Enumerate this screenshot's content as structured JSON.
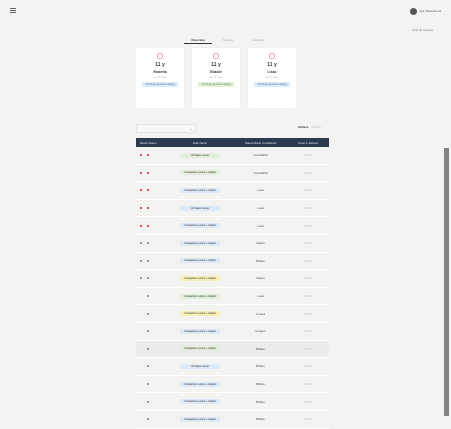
{
  "topbar": {
    "user_name": "Ilya Tiuloutikova",
    "right_link": "Find all reviews"
  },
  "tabs": [
    "Overview",
    "Settings",
    "Analytics"
  ],
  "cards": [
    {
      "value": "11 y",
      "label": "Roberta",
      "sub": "per 30 days",
      "button": "Trend all you have ranking"
    },
    {
      "value": "11 y",
      "label": "Eliasbr",
      "sub": "per 30 days",
      "button": "Trend all you have ranking"
    },
    {
      "value": "11 y",
      "label": "Lisac",
      "sub": "per 30 days",
      "button": "Trend all you have ranking"
    }
  ],
  "filter": {
    "placeholder": "Select region"
  },
  "sort": {
    "a": "Ahhere",
    "b": "Ahhere"
  },
  "table": {
    "headers": [
      "Report Name",
      "Date Name",
      "Status Rank Conditions",
      "Open in Review"
    ],
    "rows": [
      {
        "mark1": "red",
        "mark2": "red",
        "pill": "All Status review",
        "color": "#e1eed9",
        "status": "Gucci&Pat",
        "date": "2/3/42"
      },
      {
        "mark1": "red",
        "mark2": "red",
        "pill": "Comparison reports + insights",
        "color": "#e1eed9",
        "status": "Gucci&Pat",
        "date": "2/3/42"
      },
      {
        "mark1": "red",
        "mark2": "red",
        "pill": "Comparison reports + insights",
        "color": "#dce9f7",
        "status": "Luca",
        "date": "2/3/42"
      },
      {
        "mark1": "red",
        "mark2": "red",
        "pill": "All Status review",
        "color": "#dce9f7",
        "status": "Luca",
        "date": "2/3/42"
      },
      {
        "mark1": "red",
        "mark2": "red",
        "pill": "Comparison reports + insights",
        "color": "#dce9f7",
        "status": "Luca",
        "date": "2/3/42"
      },
      {
        "mark1": "grey",
        "mark2": "grey",
        "pill": "Comparison reports + insights",
        "color": "#dce9f7",
        "status": "Xiaom",
        "date": "2/3/42"
      },
      {
        "mark1": "grey",
        "mark2": "grey",
        "pill": "Comparison reports + insights",
        "color": "#dce9f7",
        "status": "Bifahe",
        "date": "2/3/42"
      },
      {
        "mark1": "grey",
        "mark2": "grey",
        "pill": "Comparison reports + insights",
        "color": "#f7efb8",
        "status": "Xiaom",
        "date": "2/3/42"
      },
      {
        "mark1": "none",
        "mark2": "grey",
        "pill": "Comparison reports + insights",
        "color": "#e1eed9",
        "status": "Luca",
        "date": "2/3/42"
      },
      {
        "mark1": "none",
        "mark2": "grey",
        "pill": "Comparison reports + insights",
        "color": "#f7efb8",
        "status": "C-taua",
        "date": "2/3/42"
      },
      {
        "mark1": "none",
        "mark2": "grey",
        "pill": "Comparison reports + insights",
        "color": "#dce9f7",
        "status": "Uniquor",
        "date": "2/3/42"
      },
      {
        "mark1": "none",
        "mark2": "grey",
        "pill": "Comparison reports + insights",
        "color": "#e1eed9",
        "status": "Bifahe",
        "date": "2/3/42",
        "highlight": true
      },
      {
        "mark1": "none",
        "mark2": "grey",
        "pill": "All Status review",
        "color": "#dce9f7",
        "status": "Bifahe",
        "date": "2/3/42"
      },
      {
        "mark1": "none",
        "mark2": "grey",
        "pill": "Comparison reports + insights",
        "color": "#dce9f7",
        "status": "Bifahe",
        "date": "2/3/42"
      },
      {
        "mark1": "none",
        "mark2": "grey",
        "pill": "Comparison reports + insights",
        "color": "#dce9f7",
        "status": "Bifahe",
        "date": "2/3/42"
      },
      {
        "mark1": "none",
        "mark2": "grey",
        "pill": "Comparison reports + insights",
        "color": "#dce9f7",
        "status": "Bifahe",
        "date": "2/3/42"
      }
    ]
  },
  "colors": {
    "header": "#2c3b4f",
    "red_mark": "#d9534f",
    "grey_mark": "#999999",
    "icon": "#e89a94"
  }
}
